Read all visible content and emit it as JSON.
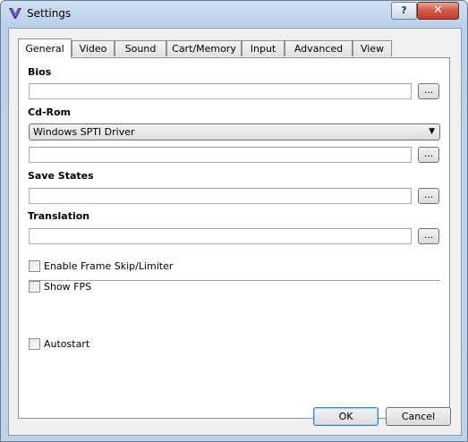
{
  "window": {
    "title": "Settings",
    "help_label": "?",
    "close_label": "✕"
  },
  "tabs": [
    {
      "label": "General"
    },
    {
      "label": "Video"
    },
    {
      "label": "Sound"
    },
    {
      "label": "Cart/Memory"
    },
    {
      "label": "Input"
    },
    {
      "label": "Advanced"
    },
    {
      "label": "View"
    }
  ],
  "general": {
    "bios": {
      "label": "Bios",
      "value": "",
      "browse_label": "..."
    },
    "cdrom": {
      "label": "Cd-Rom",
      "driver_selected": "Windows SPTI Driver",
      "value": "",
      "browse_label": "..."
    },
    "save_states": {
      "label": "Save States",
      "value": "",
      "browse_label": "..."
    },
    "translation": {
      "label": "Translation",
      "value": "",
      "browse_label": "..."
    },
    "options": {
      "frame_skip": {
        "label": "Enable Frame Skip/Limiter",
        "checked": false
      },
      "show_fps": {
        "label": "Show FPS",
        "checked": false
      },
      "autostart": {
        "label": "Autostart",
        "checked": false
      }
    }
  },
  "buttons": {
    "ok": "OK",
    "cancel": "Cancel"
  },
  "colors": {
    "accent": "#3c7fb1",
    "close": "#c13d27",
    "frame": "#b9d1ea"
  },
  "icons": {
    "app": "yabause-logo-icon",
    "dropdown": "chevron-down-icon"
  }
}
